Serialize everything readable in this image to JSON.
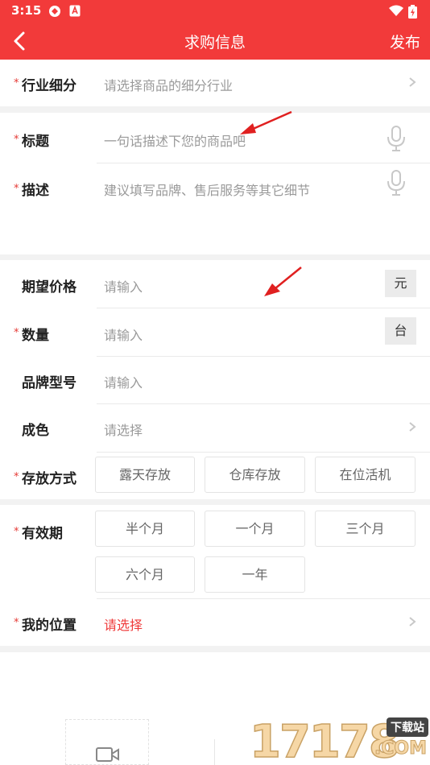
{
  "status_bar": {
    "time": "3:15",
    "icons": [
      "sync-icon",
      "app-notification-icon",
      "wifi-icon",
      "battery-charging-icon"
    ]
  },
  "nav": {
    "title": "求购信息",
    "publish_label": "发布",
    "back_icon": "chevron-left-icon"
  },
  "form": {
    "industry": {
      "label": "行业细分",
      "placeholder": "请选择商品的细分行业",
      "required": true
    },
    "title": {
      "label": "标题",
      "placeholder": "一句话描述下您的商品吧",
      "required": true
    },
    "description": {
      "label": "描述",
      "placeholder": "建议填写品牌、售后服务等其它细节",
      "required": true
    },
    "price": {
      "label": "期望价格",
      "placeholder": "请输入",
      "unit": "元",
      "required": false
    },
    "quantity": {
      "label": "数量",
      "placeholder": "请输入",
      "unit": "台",
      "required": true
    },
    "brand_model": {
      "label": "品牌型号",
      "placeholder": "请输入",
      "required": false
    },
    "condition": {
      "label": "成色",
      "placeholder": "请选择",
      "required": false
    },
    "storage": {
      "label": "存放方式",
      "required": true,
      "options": [
        "露天存放",
        "仓库存放",
        "在位活机"
      ]
    },
    "validity": {
      "label": "有效期",
      "required": true,
      "options": [
        "半个月",
        "一个月",
        "三个月",
        "六个月",
        "一年"
      ]
    },
    "location": {
      "label": "我的位置",
      "placeholder": "请选择",
      "required": true
    }
  },
  "watermark": {
    "digits": "17178",
    "tag": "下载站",
    "suffix": ".COM"
  },
  "colors": {
    "accent": "#f23a3a",
    "required_star": "#e53935",
    "placeholder": "#9a9a9a"
  }
}
